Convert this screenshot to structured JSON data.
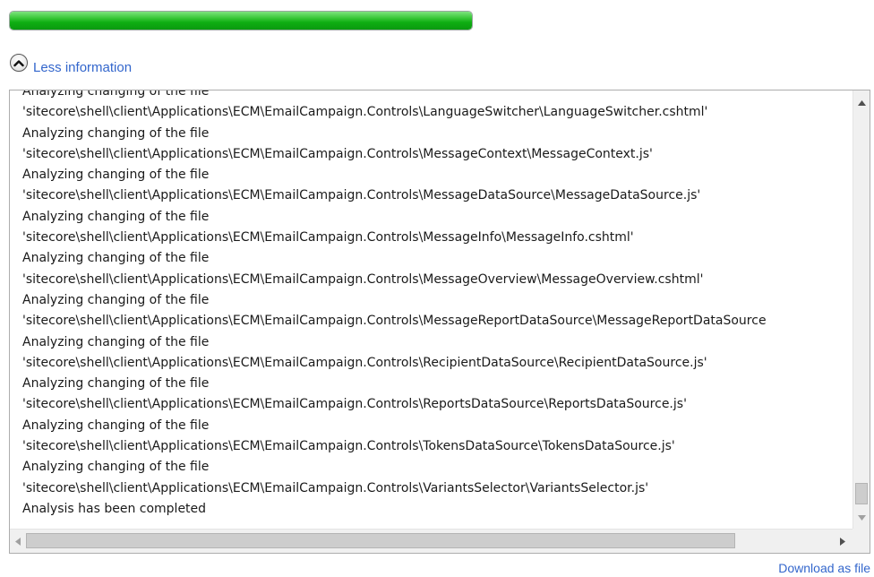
{
  "progress": {
    "fraction": 1.0,
    "color": "#10ab14"
  },
  "details_toggle": {
    "icon": "chevron-up-icon",
    "label": "Less information"
  },
  "log": {
    "lines": [
      "Analyzing changing of the file",
      "'sitecore\\shell\\client\\Applications\\ECM\\EmailCampaign.Controls\\LanguageSwitcher\\LanguageSwitcher.cshtml'",
      "Analyzing changing of the file",
      "'sitecore\\shell\\client\\Applications\\ECM\\EmailCampaign.Controls\\MessageContext\\MessageContext.js'",
      "Analyzing changing of the file",
      "'sitecore\\shell\\client\\Applications\\ECM\\EmailCampaign.Controls\\MessageDataSource\\MessageDataSource.js'",
      "Analyzing changing of the file",
      "'sitecore\\shell\\client\\Applications\\ECM\\EmailCampaign.Controls\\MessageInfo\\MessageInfo.cshtml'",
      "Analyzing changing of the file",
      "'sitecore\\shell\\client\\Applications\\ECM\\EmailCampaign.Controls\\MessageOverview\\MessageOverview.cshtml'",
      "Analyzing changing of the file",
      "'sitecore\\shell\\client\\Applications\\ECM\\EmailCampaign.Controls\\MessageReportDataSource\\MessageReportDataSource",
      "Analyzing changing of the file",
      "'sitecore\\shell\\client\\Applications\\ECM\\EmailCampaign.Controls\\RecipientDataSource\\RecipientDataSource.js'",
      "Analyzing changing of the file",
      "'sitecore\\shell\\client\\Applications\\ECM\\EmailCampaign.Controls\\ReportsDataSource\\ReportsDataSource.js'",
      "Analyzing changing of the file",
      "'sitecore\\shell\\client\\Applications\\ECM\\EmailCampaign.Controls\\TokensDataSource\\TokensDataSource.js'",
      "Analyzing changing of the file",
      "'sitecore\\shell\\client\\Applications\\ECM\\EmailCampaign.Controls\\VariantsSelector\\VariantsSelector.js'",
      "Analysis has been completed"
    ]
  },
  "download": {
    "label": "Download as file"
  }
}
